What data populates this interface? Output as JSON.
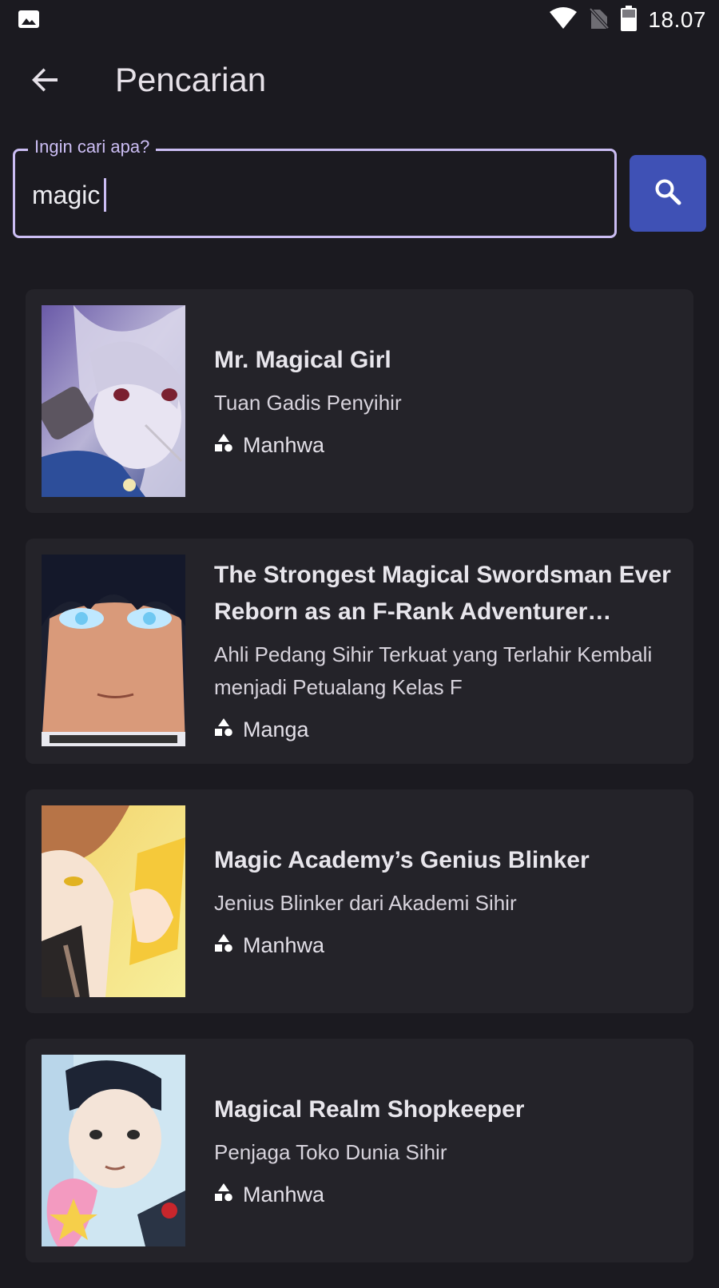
{
  "status_bar": {
    "time": "18.07",
    "icons": [
      "gallery-icon",
      "wifi-icon",
      "no-sim-icon",
      "battery-icon"
    ]
  },
  "app_bar": {
    "title": "Pencarian",
    "back_icon": "arrow-back-icon"
  },
  "search": {
    "label": "Ingin cari apa?",
    "value": "magic",
    "button_icon": "search-icon"
  },
  "results": [
    {
      "title": "Mr. Magical Girl",
      "subtitle": "Tuan Gadis Penyihir",
      "type": "Manhwa",
      "type_icon": "category-icon"
    },
    {
      "title": "The Strongest Magical Swordsman Ever Reborn as an F-Rank Adventurer…",
      "subtitle": "Ahli Pedang Sihir Terkuat yang Terlahir Kembali menjadi Petualang Kelas F",
      "type": "Manga",
      "type_icon": "category-icon"
    },
    {
      "title": "Magic Academy’s Genius Blinker",
      "subtitle": "Jenius Blinker dari Akademi Sihir",
      "type": "Manhwa",
      "type_icon": "category-icon"
    },
    {
      "title": "Magical Realm Shopkeeper",
      "subtitle": "Penjaga Toko Dunia Sihir",
      "type": "Manhwa",
      "type_icon": "category-icon"
    }
  ],
  "colors": {
    "background": "#1b1a20",
    "card": "#242329",
    "accent": "#cbbdf3",
    "search_button": "#3f51b5"
  }
}
